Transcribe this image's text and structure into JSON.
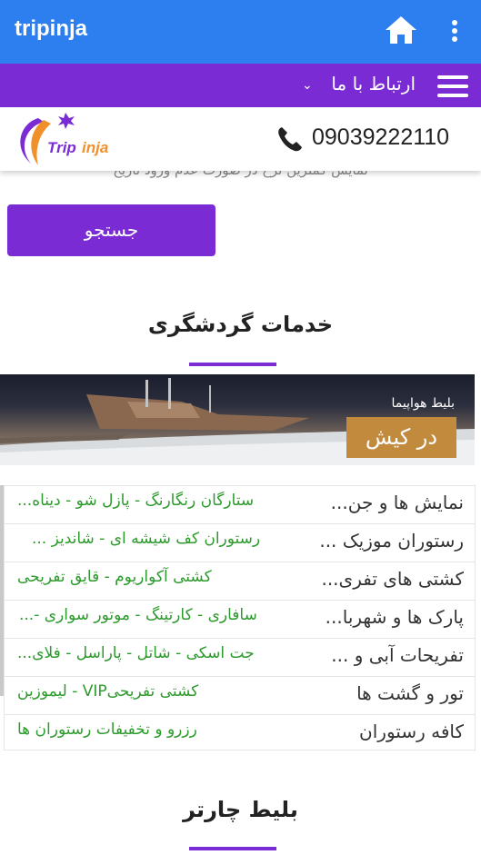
{
  "appbar": {
    "title": "tripinja",
    "home_icon": "home-icon",
    "menu_icon": "more-vert-icon",
    "color": "#2d7ff0"
  },
  "menubar": {
    "label": "ارتباط با ما",
    "chevron": "⌄",
    "menu_icon": "hamburger-icon",
    "color": "#7b2bd4"
  },
  "header": {
    "logo_text_trip": "Trip",
    "logo_text_inja": "inja",
    "phone_number": "09039222110",
    "phone_icon": "phone-icon"
  },
  "hint": "نمایش کمترین نرخ در صورت عدم ورود تاریخ",
  "search": {
    "button_label": "جستجو"
  },
  "tourism_section": {
    "title": "خدمات گردشگری",
    "banner_caption": "بلیط هواپیما",
    "banner_tag": "در کیش",
    "rows": [
      {
        "name": "نمایش ها و جن...",
        "items": "ستارگان رنگارنگ - پازل شو - دیناه..."
      },
      {
        "name": "رستوران موزیک ...",
        "items": "رستوران کف شیشه ای - شاندیز ..."
      },
      {
        "name": "کشتی های تفری...",
        "items": "کشتی آکواریوم - قایق تفریحی"
      },
      {
        "name": "پارک ها و شهربا...",
        "items": "سافاری - کارتینگ - موتور سواری -..."
      },
      {
        "name": "تفریحات آبی و ...",
        "items": "جت اسکی - شاتل - پاراسل - فلای..."
      },
      {
        "name": "تور و گشت ها",
        "items": "کشتی تفریحیVIP - لیموزین"
      },
      {
        "name": "کافه رستوران",
        "items": "رزرو و تخفیفات رستوران ها"
      }
    ]
  },
  "charter_section": {
    "title": "بلیط چارتر"
  },
  "colors": {
    "accent_purple": "#7b2bd4",
    "link_green": "#2d9a2d",
    "banner_tag": "#c28a3c"
  }
}
